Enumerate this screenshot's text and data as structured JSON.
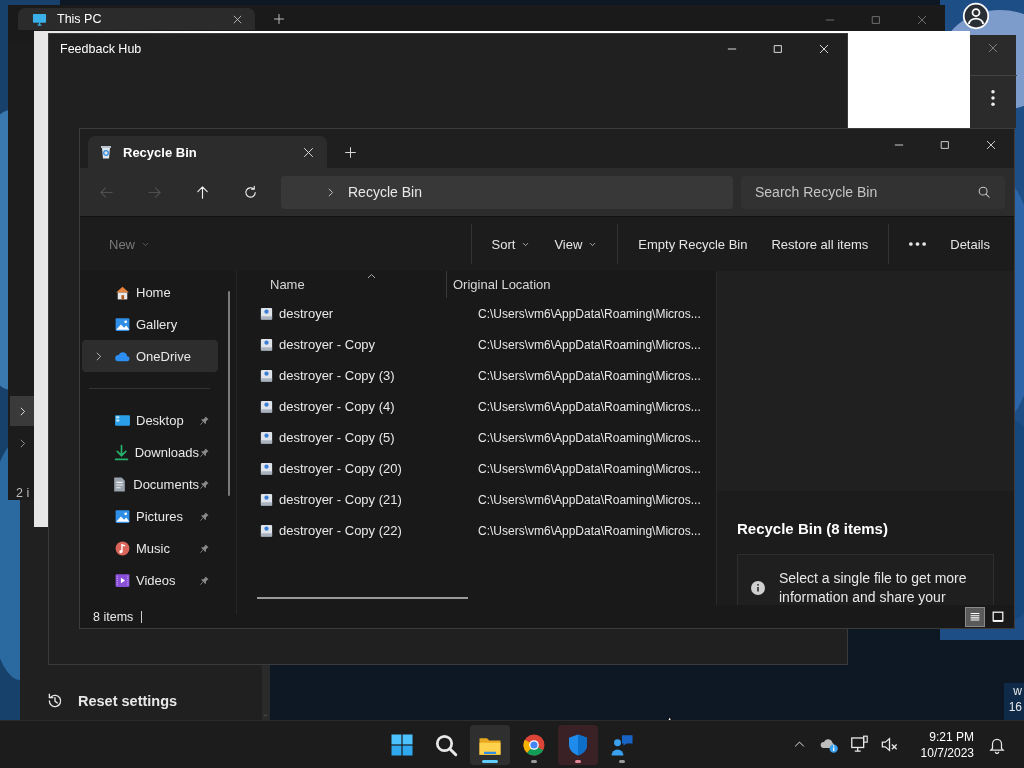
{
  "this_pc_window": {
    "tab": "This PC",
    "tree_items": [
      {
        "selected": true
      },
      {
        "selected": false
      }
    ],
    "status": "2 i"
  },
  "settings_window": {
    "items": [
      {
        "label": "Reset settings"
      }
    ]
  },
  "edge_window": {
    "texts": [
      "w",
      "16"
    ]
  },
  "feedback_hub": {
    "title": "Feedback Hub"
  },
  "explorer": {
    "tab": {
      "label": "Recycle Bin",
      "selected": true
    },
    "nav": [
      {
        "kind": "back",
        "disabled": true
      },
      {
        "kind": "forward",
        "disabled": true
      },
      {
        "kind": "up",
        "disabled": false
      },
      {
        "kind": "refresh",
        "disabled": false
      }
    ],
    "address": {
      "path": "Recycle Bin"
    },
    "search": {
      "placeholder": "Search Recycle Bin"
    },
    "toolbar": [
      [
        {
          "kind": "dropdown",
          "label": "New",
          "disabled": true
        }
      ],
      [
        {
          "kind": "dropdown",
          "label": "Sort",
          "disabled": false
        },
        {
          "kind": "dropdown",
          "label": "View",
          "disabled": false
        }
      ],
      [
        {
          "kind": "button",
          "label": "Empty Recycle Bin",
          "disabled": false
        },
        {
          "kind": "button",
          "label": "Restore all items",
          "disabled": false
        }
      ],
      [
        {
          "kind": "more",
          "disabled": false
        },
        {
          "kind": "button",
          "label": "Details",
          "disabled": false
        }
      ]
    ],
    "sidebar": {
      "groups": [
        [
          {
            "label": "Home",
            "kind": "home",
            "selected": false,
            "has_children": false,
            "pinned": false
          },
          {
            "label": "Gallery",
            "kind": "gallery",
            "selected": false,
            "has_children": false,
            "pinned": false
          },
          {
            "label": "OneDrive",
            "kind": "onedrive",
            "selected": true,
            "has_children": true,
            "pinned": false
          }
        ],
        [
          {
            "label": "Desktop",
            "kind": "desktop",
            "selected": false,
            "has_children": false,
            "pinned": true
          },
          {
            "label": "Downloads",
            "kind": "downloads",
            "selected": false,
            "has_children": false,
            "pinned": true
          },
          {
            "label": "Documents",
            "kind": "documents",
            "selected": false,
            "has_children": false,
            "pinned": true
          },
          {
            "label": "Pictures",
            "kind": "pictures",
            "selected": false,
            "has_children": false,
            "pinned": true
          },
          {
            "label": "Music",
            "kind": "music",
            "selected": false,
            "has_children": false,
            "pinned": true
          },
          {
            "label": "Videos",
            "kind": "videos",
            "selected": false,
            "has_children": false,
            "pinned": true
          }
        ]
      ]
    },
    "columns": [
      {
        "label": "Name",
        "sorted": true
      },
      {
        "label": "Original Location",
        "sorted": false
      }
    ],
    "rows": [
      {
        "name": "destroyer",
        "location": "C:\\Users\\vm6\\AppData\\Roaming\\Micros..."
      },
      {
        "name": "destroyer - Copy",
        "location": "C:\\Users\\vm6\\AppData\\Roaming\\Micros..."
      },
      {
        "name": "destroyer - Copy (3)",
        "location": "C:\\Users\\vm6\\AppData\\Roaming\\Micros..."
      },
      {
        "name": "destroyer - Copy (4)",
        "location": "C:\\Users\\vm6\\AppData\\Roaming\\Micros..."
      },
      {
        "name": "destroyer - Copy (5)",
        "location": "C:\\Users\\vm6\\AppData\\Roaming\\Micros..."
      },
      {
        "name": "destroyer - Copy (20)",
        "location": "C:\\Users\\vm6\\AppData\\Roaming\\Micros..."
      },
      {
        "name": "destroyer - Copy (21)",
        "location": "C:\\Users\\vm6\\AppData\\Roaming\\Micros..."
      },
      {
        "name": "destroyer - Copy (22)",
        "location": "C:\\Users\\vm6\\AppData\\Roaming\\Micros..."
      }
    ],
    "status": "8 items",
    "details": {
      "title": "Recycle Bin (8 items)",
      "info": "Select a single file to get more information and share your"
    },
    "view_modes": [
      {
        "kind": "details",
        "selected": true
      },
      {
        "kind": "tiles",
        "selected": false
      }
    ]
  },
  "taskbar": {
    "apps": [
      {
        "kind": "start",
        "selected": false,
        "running": false,
        "attention": false
      },
      {
        "kind": "search",
        "selected": false,
        "running": false,
        "attention": false
      },
      {
        "kind": "explorer",
        "selected": true,
        "running": true,
        "attention": false
      },
      {
        "kind": "chrome",
        "selected": false,
        "running": true,
        "attention": false
      },
      {
        "kind": "defender",
        "selected": false,
        "running": true,
        "attention": true
      },
      {
        "kind": "people",
        "selected": false,
        "running": true,
        "attention": false
      }
    ],
    "tray": [
      {
        "kind": "chevron"
      },
      {
        "kind": "onedrive"
      },
      {
        "kind": "network"
      },
      {
        "kind": "sound_muted"
      }
    ],
    "time": "9:21 PM",
    "date": "10/7/2023"
  }
}
